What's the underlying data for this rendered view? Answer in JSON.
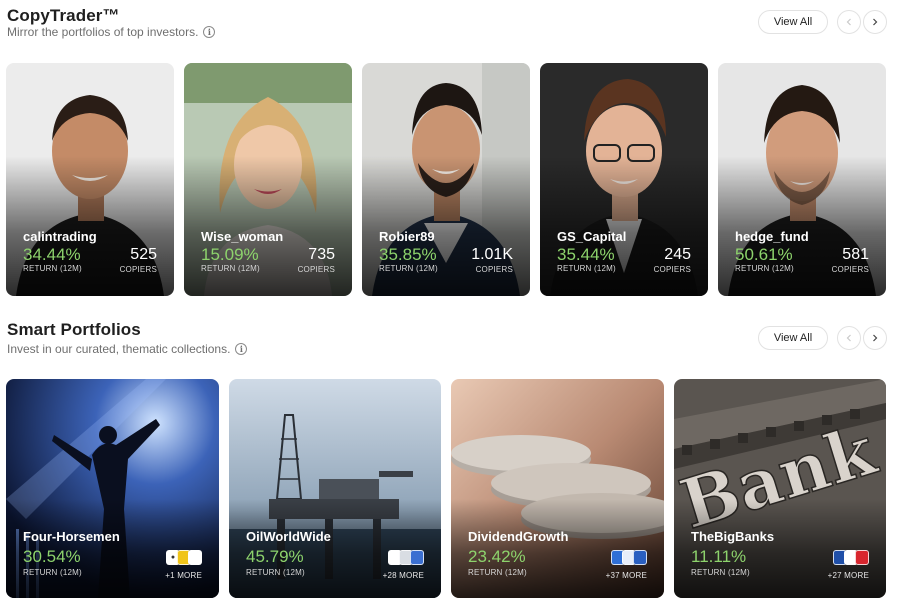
{
  "copytrader": {
    "title": "CopyTrader™",
    "subtitle": "Mirror the portfolios of top investors.",
    "view_all": "View All",
    "traders": [
      {
        "name": "calintrading",
        "return": "34.44%",
        "return_label": "RETURN (12M)",
        "copiers": "525",
        "copiers_label": "COPIERS"
      },
      {
        "name": "Wise_woman",
        "return": "15.09%",
        "return_label": "RETURN (12M)",
        "copiers": "735",
        "copiers_label": "COPIERS"
      },
      {
        "name": "Robier89",
        "return": "35.85%",
        "return_label": "RETURN (12M)",
        "copiers": "1.01K",
        "copiers_label": "COPIERS"
      },
      {
        "name": "GS_Capital",
        "return": "35.44%",
        "return_label": "RETURN (12M)",
        "copiers": "245",
        "copiers_label": "COPIERS"
      },
      {
        "name": "hedge_fund",
        "return": "50.61%",
        "return_label": "RETURN (12M)",
        "copiers": "581",
        "copiers_label": "COPIERS"
      }
    ]
  },
  "smart_portfolios": {
    "title": "Smart Portfolios",
    "subtitle": "Invest in our curated, thematic collections.",
    "view_all": "View All",
    "portfolios": [
      {
        "name": "Four-Horsemen",
        "return": "30.54%",
        "return_label": "RETURN (12M)",
        "more": "+1 MORE"
      },
      {
        "name": "OilWorldWide",
        "return": "45.79%",
        "return_label": "RETURN (12M)",
        "more": "+28 MORE"
      },
      {
        "name": "DividendGrowth",
        "return": "23.42%",
        "return_label": "RETURN (12M)",
        "more": "+37 MORE"
      },
      {
        "name": "TheBigBanks",
        "return": "11.11%",
        "return_label": "RETURN (12M)",
        "more": "+27 MORE",
        "image_text": "Bank"
      }
    ]
  },
  "colors": {
    "return_green": "#8dd36c",
    "title_text": "#1f1f1f",
    "subtitle_text": "#6f6f6f"
  },
  "icons": [
    "info-icon",
    "chevron-left-icon",
    "chevron-right-icon",
    "asset-logo-icon"
  ]
}
